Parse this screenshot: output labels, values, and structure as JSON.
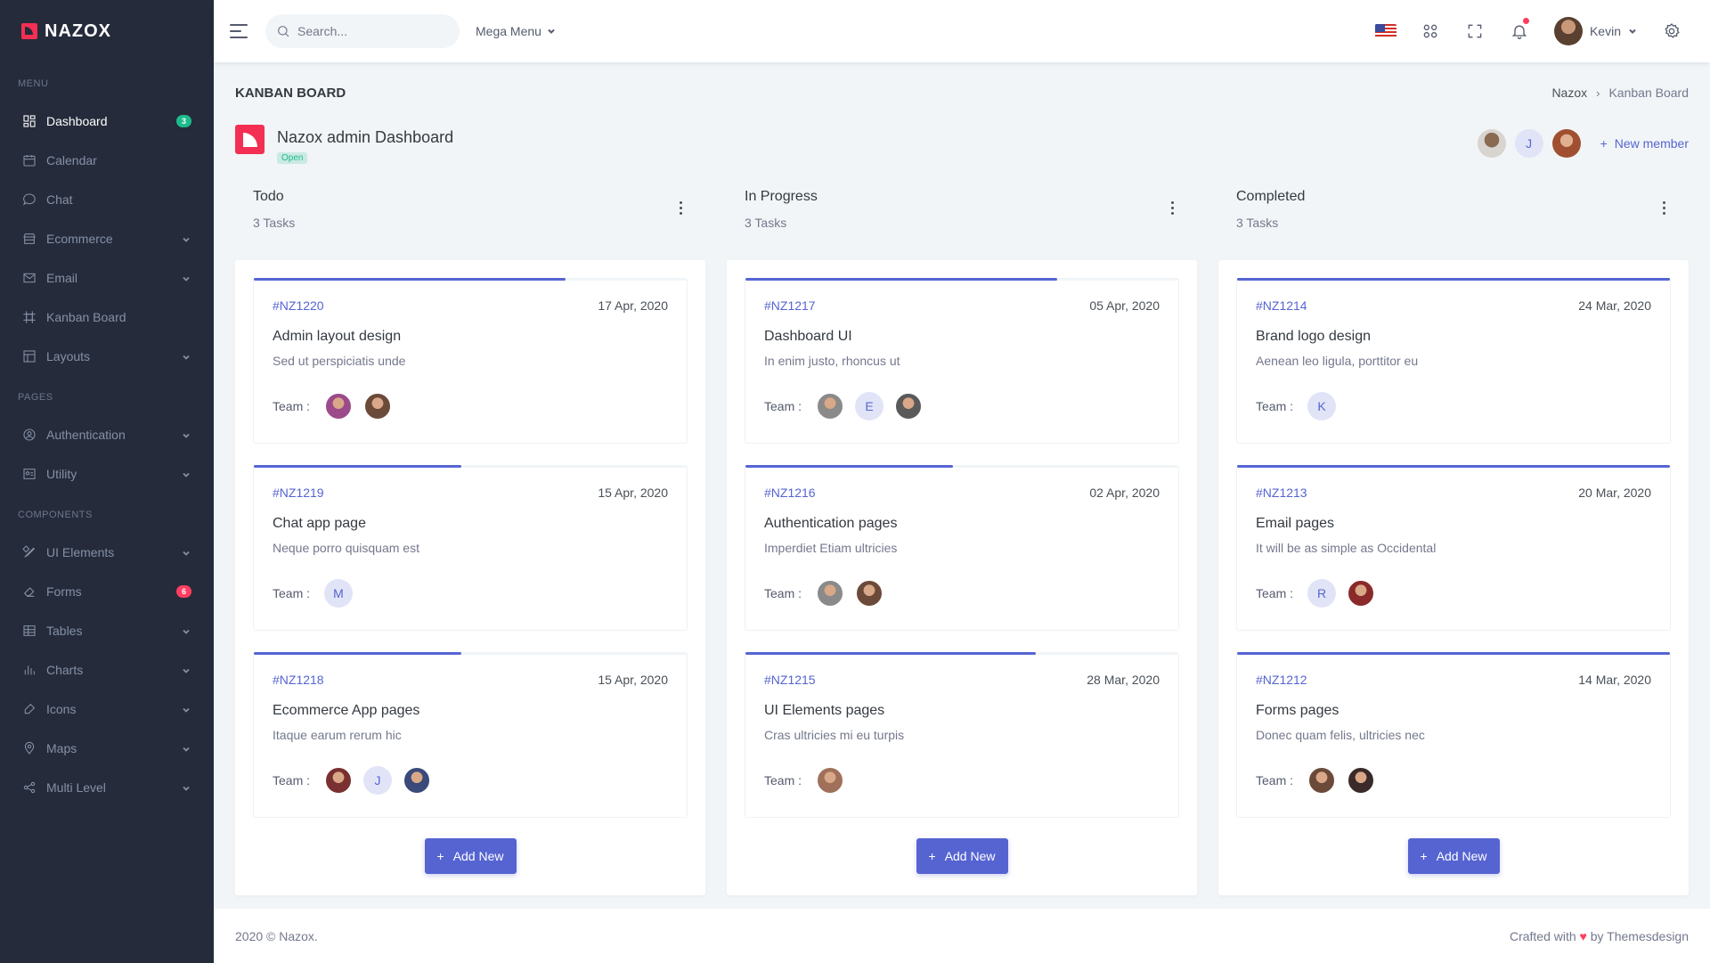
{
  "brand": {
    "name": "NAZOX",
    "color": "#f32f53"
  },
  "sidebar": {
    "sections": [
      {
        "title": "Menu",
        "items": [
          {
            "label": "Dashboard",
            "icon": "dashboard-icon",
            "badge": "3",
            "badge_color": "green",
            "active": true
          },
          {
            "label": "Calendar",
            "icon": "calendar-icon"
          },
          {
            "label": "Chat",
            "icon": "chat-icon"
          },
          {
            "label": "Ecommerce",
            "icon": "store-icon",
            "chevron": true
          },
          {
            "label": "Email",
            "icon": "mail-icon",
            "chevron": true
          },
          {
            "label": "Kanban Board",
            "icon": "artboard-icon"
          },
          {
            "label": "Layouts",
            "icon": "layout-icon",
            "chevron": true
          }
        ]
      },
      {
        "title": "Pages",
        "items": [
          {
            "label": "Authentication",
            "icon": "account-icon",
            "chevron": true
          },
          {
            "label": "Utility",
            "icon": "profile-icon",
            "chevron": true
          }
        ]
      },
      {
        "title": "Components",
        "items": [
          {
            "label": "UI Elements",
            "icon": "pencil-ruler-icon",
            "chevron": true
          },
          {
            "label": "Forms",
            "icon": "eraser-icon",
            "badge": "6",
            "badge_color": "red"
          },
          {
            "label": "Tables",
            "icon": "table-icon",
            "chevron": true
          },
          {
            "label": "Charts",
            "icon": "bar-chart-icon",
            "chevron": true
          },
          {
            "label": "Icons",
            "icon": "brush-icon",
            "chevron": true
          },
          {
            "label": "Maps",
            "icon": "map-pin-icon",
            "chevron": true
          },
          {
            "label": "Multi Level",
            "icon": "share-icon",
            "chevron": true
          }
        ]
      }
    ]
  },
  "topbar": {
    "search_placeholder": "Search...",
    "mega_menu": "Mega Menu",
    "user_name": "Kevin"
  },
  "page": {
    "title": "KANBAN BOARD",
    "breadcrumb": [
      "Nazox",
      "Kanban Board"
    ]
  },
  "project": {
    "name": "Nazox admin Dashboard",
    "status": "Open",
    "member_letter": "J",
    "new_member": "New member"
  },
  "columns": [
    {
      "title": "Todo",
      "count": "3 Tasks",
      "add_label": "Add New",
      "tasks": [
        {
          "id": "#NZ1220",
          "date": "17 Apr, 2020",
          "title": "Admin layout design",
          "desc": "Sed ut perspiciatis unde",
          "progress": 0.72,
          "team": [
            {
              "type": "img",
              "color": "#9c4a8a"
            },
            {
              "type": "img",
              "color": "#6b4a3a"
            }
          ]
        },
        {
          "id": "#NZ1219",
          "date": "15 Apr, 2020",
          "title": "Chat app page",
          "desc": "Neque porro quisquam est",
          "progress": 0.48,
          "team": [
            {
              "type": "letter",
              "letter": "M"
            }
          ]
        },
        {
          "id": "#NZ1218",
          "date": "15 Apr, 2020",
          "title": "Ecommerce App pages",
          "desc": "Itaque earum rerum hic",
          "progress": 0.48,
          "team": [
            {
              "type": "img",
              "color": "#7a3030"
            },
            {
              "type": "letter",
              "letter": "J"
            },
            {
              "type": "img",
              "color": "#3a4a7a"
            }
          ]
        }
      ]
    },
    {
      "title": "In Progress",
      "count": "3 Tasks",
      "add_label": "Add New",
      "tasks": [
        {
          "id": "#NZ1217",
          "date": "05 Apr, 2020",
          "title": "Dashboard UI",
          "desc": "In enim justo, rhoncus ut",
          "progress": 0.72,
          "team": [
            {
              "type": "img",
              "color": "#8a8a8a"
            },
            {
              "type": "letter",
              "letter": "E"
            },
            {
              "type": "img",
              "color": "#5a5a5a"
            }
          ]
        },
        {
          "id": "#NZ1216",
          "date": "02 Apr, 2020",
          "title": "Authentication pages",
          "desc": "Imperdiet Etiam ultricies",
          "progress": 0.48,
          "team": [
            {
              "type": "img",
              "color": "#8a8a8a"
            },
            {
              "type": "img",
              "color": "#6b4a3a"
            }
          ]
        },
        {
          "id": "#NZ1215",
          "date": "28 Mar, 2020",
          "title": "UI Elements pages",
          "desc": "Cras ultricies mi eu turpis",
          "progress": 0.67,
          "team": [
            {
              "type": "img",
              "color": "#a0705a"
            }
          ]
        }
      ]
    },
    {
      "title": "Completed",
      "count": "3 Tasks",
      "add_label": "Add New",
      "tasks": [
        {
          "id": "#NZ1214",
          "date": "24 Mar, 2020",
          "title": "Brand logo design",
          "desc": "Aenean leo ligula, porttitor eu",
          "progress": 1.0,
          "team": [
            {
              "type": "letter",
              "letter": "K"
            }
          ]
        },
        {
          "id": "#NZ1213",
          "date": "20 Mar, 2020",
          "title": "Email pages",
          "desc": "It will be as simple as Occidental",
          "progress": 1.0,
          "team": [
            {
              "type": "letter",
              "letter": "R"
            },
            {
              "type": "img",
              "color": "#8a2a2a"
            }
          ]
        },
        {
          "id": "#NZ1212",
          "date": "14 Mar, 2020",
          "title": "Forms pages",
          "desc": "Donec quam felis, ultricies nec",
          "progress": 1.0,
          "team": [
            {
              "type": "img",
              "color": "#6b4a3a"
            },
            {
              "type": "img",
              "color": "#3a2a2a"
            }
          ]
        }
      ]
    }
  ],
  "footer": {
    "left": "2020 © Nazox.",
    "right_prefix": "Crafted with",
    "right_suffix": "by Themesdesign"
  },
  "labels": {
    "team": "Team :"
  },
  "colors": {
    "accent": "#5664d2",
    "sidebar_bg": "#252b3b",
    "success": "#1cbb8c",
    "danger": "#ff3d60"
  }
}
